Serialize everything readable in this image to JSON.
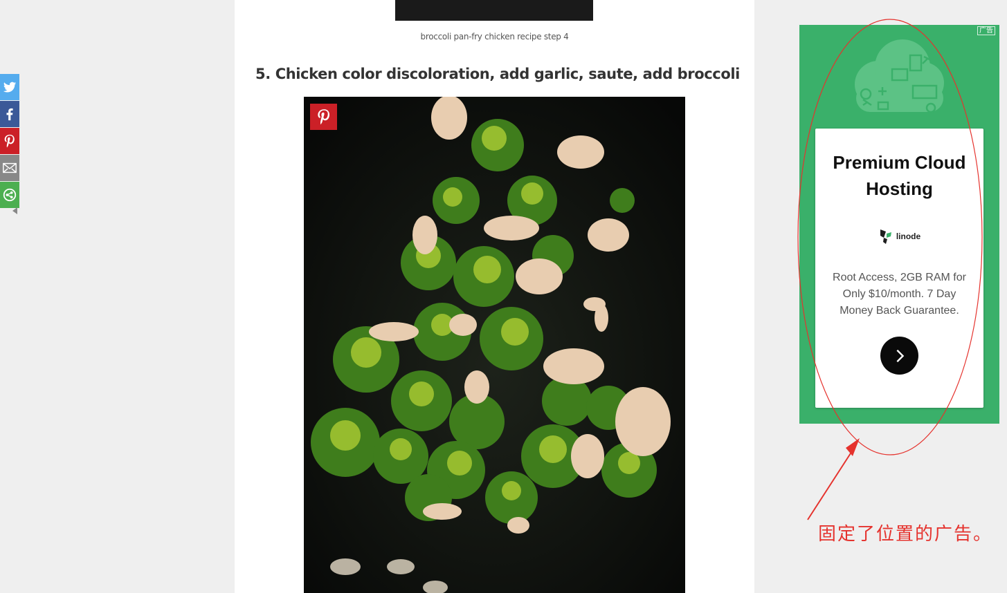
{
  "article": {
    "prev_caption": "broccoli pan-fry chicken recipe step 4",
    "step_heading": "5. Chicken color discoloration, add garlic, saute, add broccoli"
  },
  "sharebar": {
    "items": [
      {
        "icon": "twitter-icon",
        "color": "#55acee"
      },
      {
        "icon": "facebook-icon",
        "color": "#3b5998"
      },
      {
        "icon": "pinterest-icon",
        "color": "#cb2027"
      },
      {
        "icon": "email-icon",
        "color": "#888888"
      },
      {
        "icon": "more-share-icon",
        "color": "#4caf50"
      }
    ]
  },
  "ad": {
    "badge": "广告",
    "title": "Premium Cloud Hosting",
    "brand": "linode",
    "description": "Root Access, 2GB RAM for Only $10/month. 7 Day Money Back Guarantee.",
    "background": "#3ab06a"
  },
  "annotation": {
    "text": "固定了位置的广告。",
    "color": "#e5322d"
  }
}
